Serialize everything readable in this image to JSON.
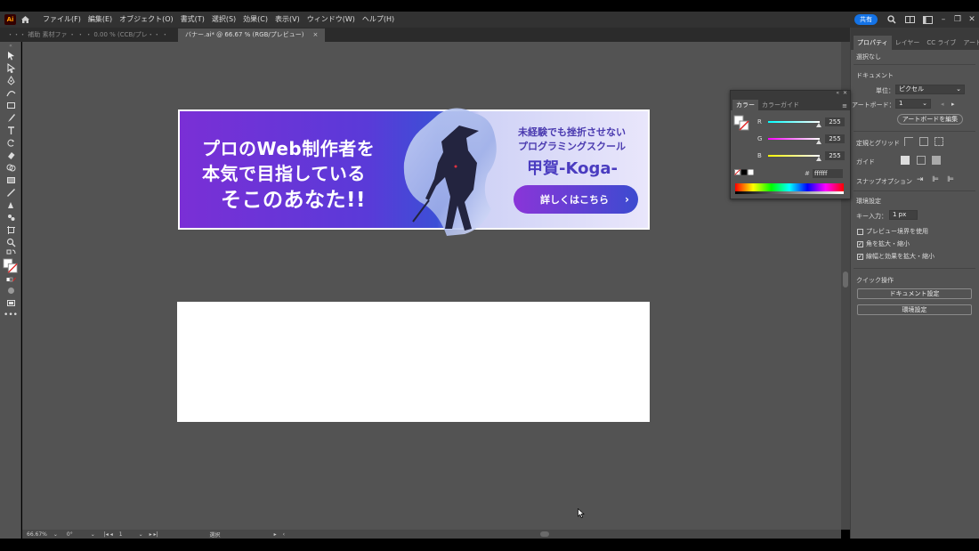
{
  "app": {
    "logo": "Ai"
  },
  "menubar": [
    "ファイル(F)",
    "編集(E)",
    "オブジェクト(O)",
    "書式(T)",
    "選択(S)",
    "効果(C)",
    "表示(V)",
    "ウィンドウ(W)",
    "ヘルプ(H)"
  ],
  "titlebar": {
    "share_label": "共有"
  },
  "tabs": {
    "inactive": "・・・ 補助 素材ファ ・ ・ ・ 0.00 % (CCB/プレ・・ ・",
    "active": "バナー.ai* @ 66.67 % (RGB/プレビュー)",
    "close": "×"
  },
  "banner": {
    "heading_1": "プロのWeb制作者を",
    "heading_2": "本気で目指している",
    "heading_3": "そこのあなた!!",
    "tagline_1": "未経験でも挫折させない",
    "tagline_2": "プログラミングスクール",
    "brand": "甲賀-Koga-",
    "cta": "詳しくはこちら",
    "cta_arrow": "›"
  },
  "statusbar": {
    "zoom": "66.67%",
    "rotate": "0°",
    "artboard_num": "1",
    "tool_status": "選択"
  },
  "properties": {
    "tabs": [
      "プロパティ",
      "レイヤー",
      "CC ライブ",
      "アートボー"
    ],
    "selection": "選択なし",
    "document_heading": "ドキュメント",
    "unit_label": "単位：",
    "unit_value": "ピクセル",
    "artboard_label": "アートボード：",
    "artboard_value": "1",
    "edit_artboard": "アートボードを編集",
    "grid_label": "定規とグリッド",
    "guides_label": "ガイド",
    "snap_label": "スナップオプション",
    "prefs_heading": "環境設定",
    "key_label": "キー入力：",
    "key_value": "1 px",
    "preview_bounds": "プレビュー境界を使用",
    "scale_corners": "角を拡大・縮小",
    "scale_strokes": "線幅と効果を拡大・縮小",
    "quick_heading": "クイック操作",
    "doc_settings": "ドキュメント設定",
    "prefs_button": "環境設定"
  },
  "color_panel": {
    "tabs": [
      "カラー",
      "カラーガイド"
    ],
    "r_label": "R",
    "r_value": "255",
    "g_label": "G",
    "g_value": "255",
    "b_label": "B",
    "b_value": "255",
    "hash": "#",
    "hex": "ffffff"
  },
  "colors": {
    "accent": "#1473e6",
    "banner_purple": "#7a2fd6",
    "banner_blue": "#3c4fd6"
  },
  "checkboxes": {
    "preview_bounds": false,
    "scale_corners": true,
    "scale_strokes": true
  }
}
